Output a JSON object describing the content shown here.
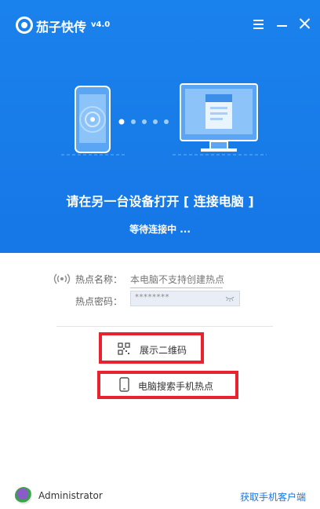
{
  "window": {
    "app_name": "茄子快传",
    "version": "v4.0",
    "controls": [
      "menu-icon",
      "minimize-icon",
      "close-icon"
    ]
  },
  "header": {
    "title": "请在另一台设备打开 [ 连接电脑 ]",
    "status": "等待连接中 ..."
  },
  "hotspot": {
    "name_label": "热点名称：",
    "name_value": "本电脑不支持创建热点",
    "password_label": "热点密码：",
    "password_value": "********"
  },
  "actions": {
    "show_qr_label": "展示二维码",
    "search_hotspot_label": "电脑搜索手机热点"
  },
  "footer": {
    "username": "Administrator",
    "get_client_label": "获取手机客户端"
  },
  "colors": {
    "primary": "#1677e6",
    "highlight_border": "#e8222e"
  }
}
